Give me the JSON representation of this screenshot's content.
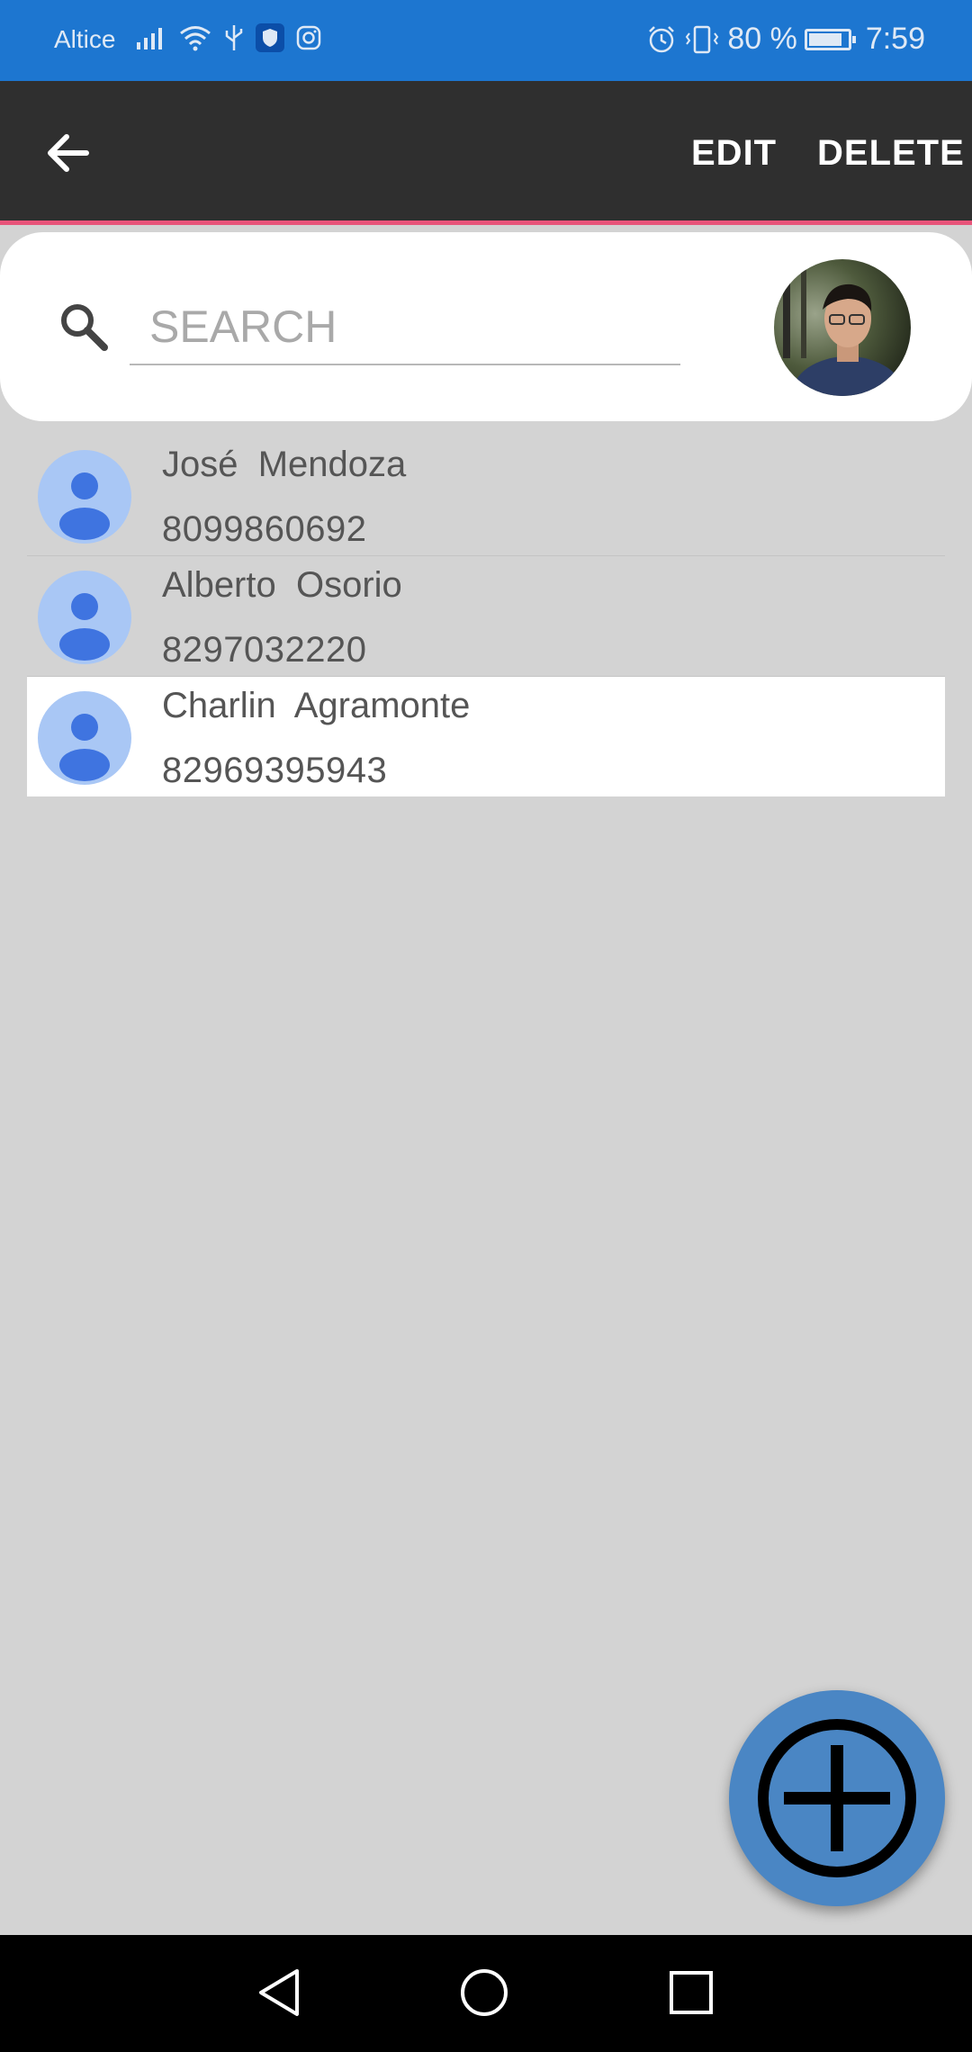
{
  "status_bar": {
    "carrier": "Altice",
    "battery": "80 %",
    "time": "7:59",
    "icons": [
      "signal-icon",
      "wifi-icon",
      "usb-icon",
      "shield-icon",
      "instagram-icon",
      "alarm-icon",
      "vibrate-icon",
      "battery-icon"
    ]
  },
  "toolbar": {
    "back_icon": "arrow-back-icon",
    "edit_label": "EDIT",
    "delete_label": "DELETE",
    "accent_color": "#e8547a"
  },
  "search": {
    "placeholder": "SEARCH",
    "value": ""
  },
  "contacts": [
    {
      "name": "José  Mendoza",
      "phone": "8099860692",
      "selected": false
    },
    {
      "name": "Alberto  Osorio",
      "phone": "8297032220",
      "selected": false
    },
    {
      "name": "Charlin  Agramonte",
      "phone": "82969395943",
      "selected": true
    }
  ],
  "fab": {
    "icon": "add-icon",
    "color": "#4a86c4"
  },
  "nav_bar": {
    "icons": [
      "nav-back-icon",
      "nav-home-icon",
      "nav-recents-icon"
    ]
  }
}
